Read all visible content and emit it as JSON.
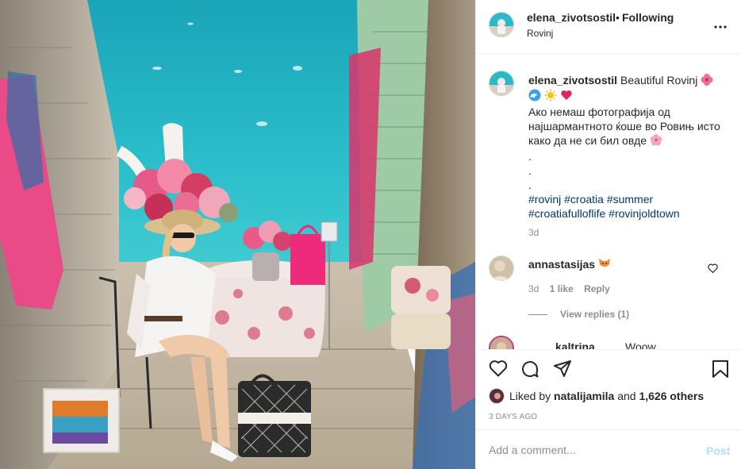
{
  "post": {
    "image_alt": "Woman in white shirt and straw hat sitting at a flower-decorated table on a narrow stone alley leading to the turquoise sea in Rovinj"
  },
  "header": {
    "username": "elena_zivotsostil",
    "separator": "•",
    "follow_label": "Following",
    "location": "Rovinj",
    "more_icon": "more-options-icon"
  },
  "caption": {
    "username": "elena_zivotsostil",
    "line1": "Beautiful Rovinj",
    "line2": "Ако немаш фотографија од најшармантното ќоше во Ровињ исто како да не си бил овде",
    "dots": [
      ".",
      ".",
      "."
    ],
    "hashtags_line1": "#rovinj #croatia #summer",
    "hashtags_line2": "#croatiafulloflife #rovinjoldtown",
    "time": "3d"
  },
  "comment": {
    "username": "annastasijas",
    "time": "3d",
    "likes": "1 like",
    "reply": "Reply",
    "view_replies": "View replies (1)"
  },
  "next_comment": {
    "username": "kaltrina",
    "text": "Woow"
  },
  "likes": {
    "prefix": "Liked by",
    "user": "natalijamila",
    "and": "and",
    "count": "1,626 others"
  },
  "date": "3 DAYS AGO",
  "add_comment": {
    "placeholder": "Add a comment...",
    "post_label": "Post"
  },
  "colors": {
    "link": "#00376b",
    "muted": "#8e8e8e",
    "post_disabled": "#b2dffc",
    "sea": "#2bb8c8"
  }
}
